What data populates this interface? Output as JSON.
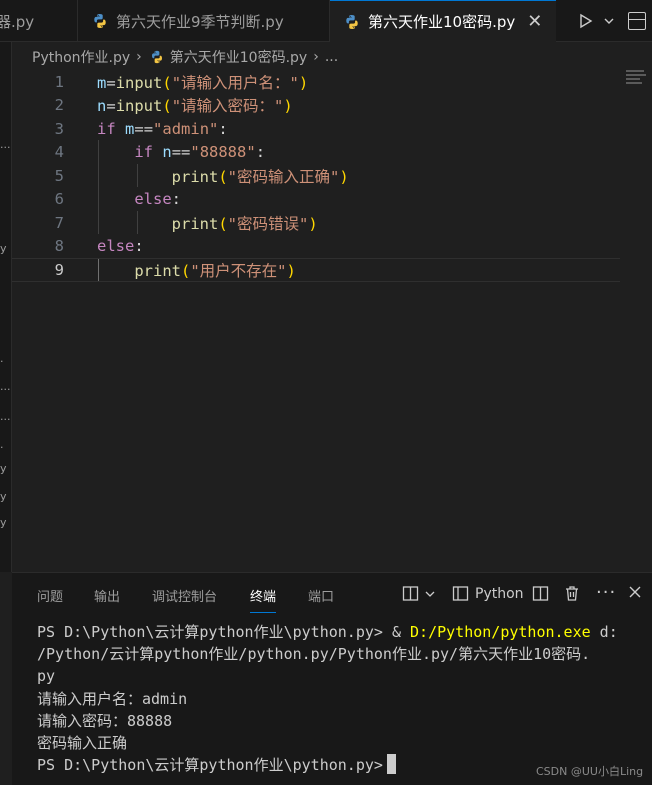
{
  "tabs": [
    {
      "label": "器.py",
      "active": false
    },
    {
      "label": "第六天作业9季节判断.py",
      "active": false
    },
    {
      "label": "第六天作业10密码.py",
      "active": true
    }
  ],
  "breadcrumb": {
    "folder": "Python作业.py",
    "file": "第六天作业10密码.py",
    "more": "..."
  },
  "editor": {
    "lines": [
      "1",
      "2",
      "3",
      "4",
      "5",
      "6",
      "7",
      "8",
      "9"
    ],
    "current_line": "9",
    "code": {
      "l1_var": "m",
      "l1_eq": "=",
      "l1_fn": "input",
      "l1_open": "(",
      "l1_str": "\"请输入用户名：\"",
      "l1_close": ")",
      "l2_var": "n",
      "l2_eq": "=",
      "l2_fn": "input",
      "l2_open": "(",
      "l2_str": "\"请输入密码：\"",
      "l2_close": ")",
      "l3_kw": "if",
      "l3_var": "m",
      "l3_op": "==",
      "l3_str": "\"admin\"",
      "l3_colon": ":",
      "l4_kw": "if",
      "l4_var": "n",
      "l4_op": "==",
      "l4_str": "\"88888\"",
      "l4_colon": ":",
      "l5_fn": "print",
      "l5_open": "(",
      "l5_str": "\"密码输入正确\"",
      "l5_close": ")",
      "l6_kw": "else",
      "l6_colon": ":",
      "l7_fn": "print",
      "l7_open": "(",
      "l7_str": "\"密码错误\"",
      "l7_close": ")",
      "l8_kw": "else",
      "l8_colon": ":",
      "l9_fn": "print",
      "l9_open": "(",
      "l9_str": "\"用户不存在\"",
      "l9_close": ")"
    }
  },
  "panel": {
    "tabs": [
      "问题",
      "输出",
      "调试控制台",
      "终端",
      "端口"
    ],
    "active_tab": "终端",
    "terminal_profile": "Python"
  },
  "terminal": {
    "line1_prompt": "PS D:\\Python\\云计算python作业\\python.py> & ",
    "line1_exe": "D:/Python/python.exe",
    "line1_rest": " d:",
    "line2": "/Python/云计算python作业/python.py/Python作业.py/第六天作业10密码.",
    "line3": "py",
    "line4": "请输入用户名：admin",
    "line5": "请输入密码：88888",
    "line6": "密码输入正确",
    "line7_prompt": "PS D:\\Python\\云计算python作业\\python.py>"
  },
  "watermark": "CSDN @UU小白Ling",
  "colors": {
    "accent": "#0078d4",
    "background": "#1f1f1f",
    "keyword": "#c586c0",
    "function": "#dcdcaa",
    "string": "#ce9178",
    "variable": "#9cdcfe"
  }
}
